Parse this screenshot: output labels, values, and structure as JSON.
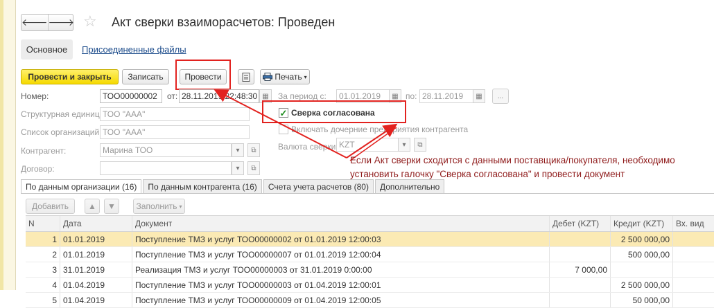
{
  "window": {
    "title": "Акт сверки взаиморасчетов: Проведен"
  },
  "nav": {
    "back": "🡐",
    "forward": "🡒"
  },
  "form_tabs": {
    "main": "Основное",
    "files": "Присоединенные файлы"
  },
  "toolbar": {
    "post_close": "Провести и закрыть",
    "save": "Записать",
    "post": "Провести",
    "print": "Печать"
  },
  "fields": {
    "number_label": "Номер:",
    "number_value": "ТОО00000002",
    "date_label": "от:",
    "date_value": "28.11.2019 22:48:30",
    "period_label": "За период с:",
    "period_from": "01.01.2019",
    "period_to_label": "по:",
    "period_to": "28.11.2019",
    "unit_label": "Структурная единица:",
    "unit_value": "ТОО \"ААА\"",
    "orgs_label": "Список организаций:",
    "orgs_value": "ТОО \"ААА\"",
    "contractor_label": "Контрагент:",
    "contractor_value": "Марина ТОО",
    "contract_label": "Договор:",
    "contract_value": "",
    "agreed_label": "Сверка согласована",
    "include_label": "Включать дочерние предприятия контрагента",
    "currency_label": "Валюта сверки:",
    "currency_value": "KZT"
  },
  "note": {
    "line1": "Если Акт сверки сходится с данными поставщика/покупателя, необходимо",
    "line2": "установить галочку \"Сверка согласована\" и провести документ"
  },
  "tabs": [
    {
      "label": "По данным организации (16)"
    },
    {
      "label": "По данным контрагента (16)"
    },
    {
      "label": "Счета учета расчетов (80)"
    },
    {
      "label": "Дополнительно"
    }
  ],
  "table_toolbar": {
    "add": "Добавить",
    "fill": "Заполнить"
  },
  "table": {
    "columns": [
      "N",
      "Дата",
      "Документ",
      "Дебет (KZT)",
      "Кредит (KZT)",
      "Вх. вид"
    ],
    "rows": [
      {
        "n": "1",
        "date": "01.01.2019",
        "doc": "Поступление ТМЗ и услуг ТОО00000002 от 01.01.2019 12:00:03",
        "debit": "",
        "credit": "2 500 000,00",
        "vid": ""
      },
      {
        "n": "2",
        "date": "01.01.2019",
        "doc": "Поступление ТМЗ и услуг ТОО00000007 от 01.01.2019 12:00:04",
        "debit": "",
        "credit": "500 000,00",
        "vid": ""
      },
      {
        "n": "3",
        "date": "31.01.2019",
        "doc": "Реализация ТМЗ и услуг ТОО00000003 от 31.01.2019 0:00:00",
        "debit": "7 000,00",
        "credit": "",
        "vid": ""
      },
      {
        "n": "4",
        "date": "01.04.2019",
        "doc": "Поступление ТМЗ и услуг ТОО00000003 от 01.04.2019 12:00:01",
        "debit": "",
        "credit": "2 500 000,00",
        "vid": ""
      },
      {
        "n": "5",
        "date": "01.04.2019",
        "doc": "Поступление ТМЗ и услуг ТОО00000009 от 01.04.2019 12:00:05",
        "debit": "",
        "credit": "50 000,00",
        "vid": ""
      }
    ]
  },
  "colors": {
    "highlight": "#e2221f",
    "note": "#8f1b1b",
    "selected_row": "#fbeab4",
    "primary_button": "#f5d900"
  }
}
